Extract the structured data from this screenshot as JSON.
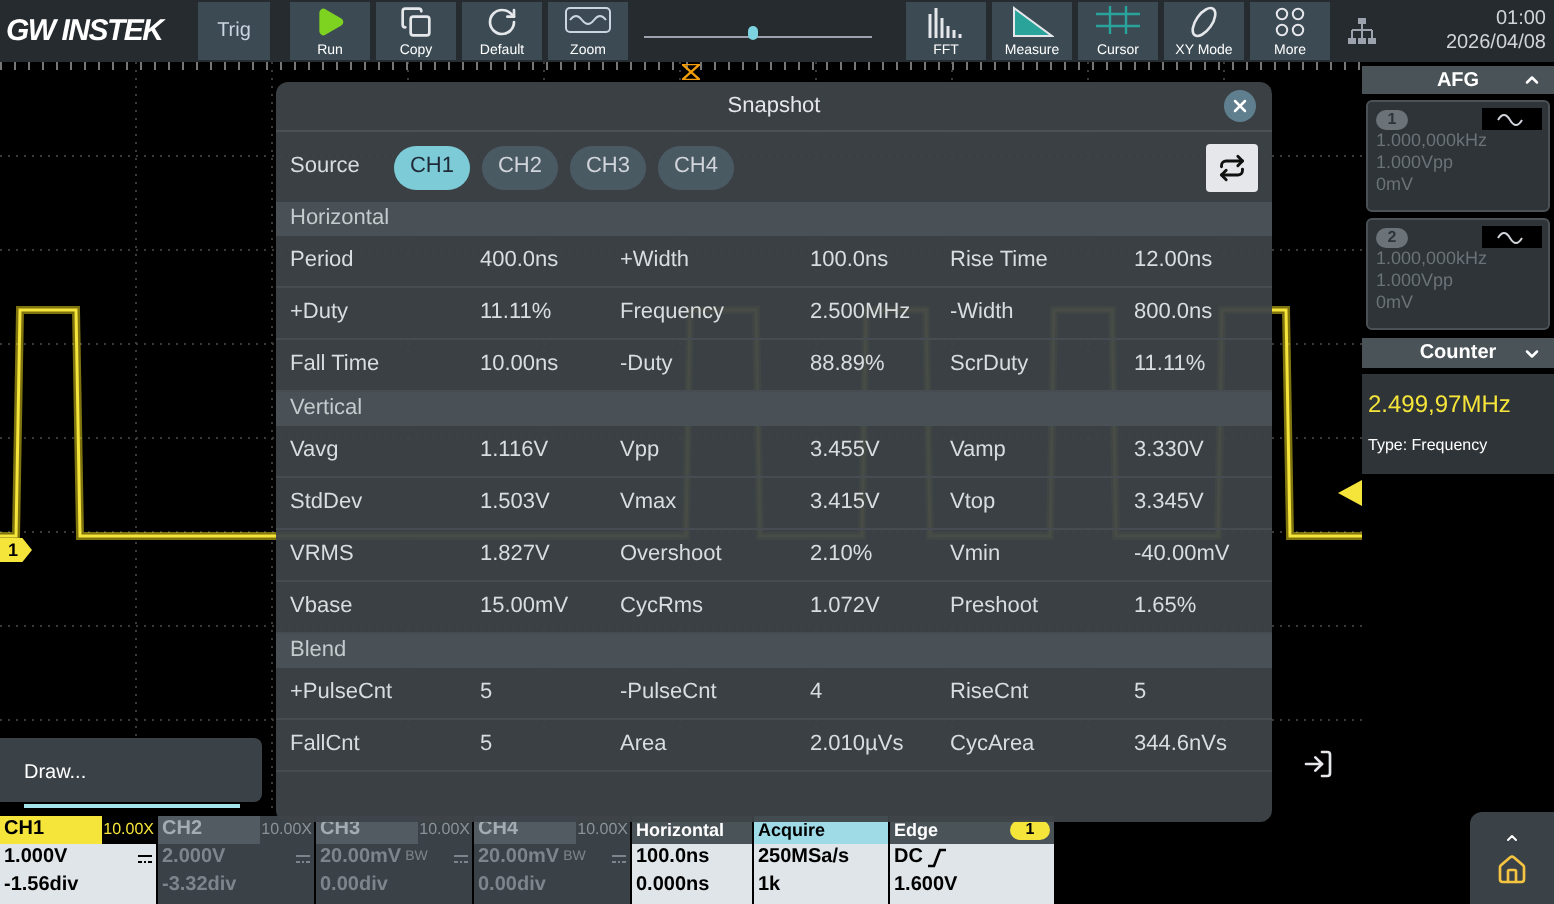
{
  "logo": "GW INSTEK",
  "trig_label": "Trig",
  "left_buttons": [
    {
      "label": "Run",
      "kind": "run"
    },
    {
      "label": "Copy",
      "kind": "copy"
    },
    {
      "label": "Default",
      "kind": "default"
    },
    {
      "label": "Zoom",
      "kind": "zoom"
    }
  ],
  "position_slider": {
    "level": 0.5
  },
  "right_buttons": [
    {
      "label": "FFT",
      "kind": "fft"
    },
    {
      "label": "Measure",
      "kind": "measure"
    },
    {
      "label": "Cursor",
      "kind": "cursor"
    },
    {
      "label": "XY Mode",
      "kind": "xy"
    },
    {
      "label": "More",
      "kind": "more"
    }
  ],
  "clock": {
    "time": "01:00",
    "date": "2026/04/08"
  },
  "channel_marker": "1",
  "dialog": {
    "title": "Snapshot",
    "source_label": "Source",
    "sources": [
      {
        "label": "CH1",
        "selected": true
      },
      {
        "label": "CH2",
        "selected": false
      },
      {
        "label": "CH3",
        "selected": false
      },
      {
        "label": "CH4",
        "selected": false
      }
    ],
    "sections": [
      {
        "title": "Horizontal",
        "rows": [
          [
            "Period",
            "400.0ns",
            "+Width",
            "100.0ns",
            "Rise Time",
            "12.00ns"
          ],
          [
            "+Duty",
            "11.11%",
            "Frequency",
            "2.500MHz",
            "-Width",
            "800.0ns"
          ],
          [
            "Fall Time",
            "10.00ns",
            "-Duty",
            "88.89%",
            "ScrDuty",
            "11.11%"
          ]
        ]
      },
      {
        "title": "Vertical",
        "rows": [
          [
            "Vavg",
            "1.116V",
            "Vpp",
            "3.455V",
            "Vamp",
            "3.330V"
          ],
          [
            "StdDev",
            "1.503V",
            "Vmax",
            "3.415V",
            "Vtop",
            "3.345V"
          ],
          [
            "VRMS",
            "1.827V",
            "Overshoot",
            "2.10%",
            "Vmin",
            "-40.00mV"
          ],
          [
            "Vbase",
            "15.00mV",
            "CycRms",
            "1.072V",
            "Preshoot",
            "1.65%"
          ]
        ]
      },
      {
        "title": "Blend",
        "rows": [
          [
            "+PulseCnt",
            "5",
            "-PulseCnt",
            "4",
            "RiseCnt",
            "5"
          ],
          [
            "FallCnt",
            "5",
            "Area",
            "2.010µVs",
            "CycArea",
            "344.6nVs"
          ]
        ]
      }
    ]
  },
  "draw_popup": "Draw...",
  "afg": {
    "title": "AFG",
    "outputs": [
      {
        "number": "1",
        "frequency": "1.000,000kHz",
        "amplitude": "1.000Vpp",
        "offset": "0mV"
      },
      {
        "number": "2",
        "frequency": "1.000,000kHz",
        "amplitude": "1.000Vpp",
        "offset": "0mV"
      }
    ]
  },
  "counter": {
    "title": "Counter",
    "value": "2.499,97MHz",
    "type": "Type: Frequency"
  },
  "channels": [
    {
      "name": "CH1",
      "probe": "10.00X",
      "scale": "1.000V",
      "position": "-1.56div",
      "active": true
    },
    {
      "name": "CH2",
      "probe": "10.00X",
      "scale": "2.000V",
      "position": "-3.32div",
      "active": false
    },
    {
      "name": "CH3",
      "probe": "10.00X",
      "scale": "20.00mV",
      "bw": "BW",
      "position": "0.00div",
      "active": false
    },
    {
      "name": "CH4",
      "probe": "10.00X",
      "scale": "20.00mV",
      "bw": "BW",
      "position": "0.00div",
      "active": false
    }
  ],
  "horizontal": {
    "title": "Horizontal",
    "scale": "100.0ns",
    "position": "0.000ns"
  },
  "acquire": {
    "title": "Acquire",
    "rate": "250MSa/s",
    "length": "1k"
  },
  "trigger": {
    "title": "Edge",
    "source": "1",
    "coupling": "DC",
    "level": "1.600V"
  }
}
